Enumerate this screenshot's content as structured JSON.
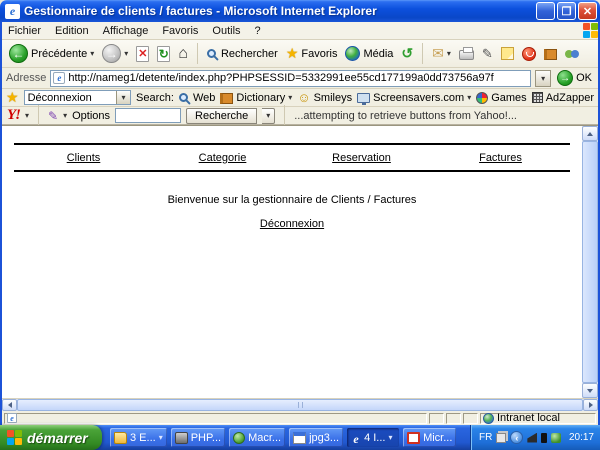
{
  "window": {
    "title": "Gestionnaire de clients / factures - Microsoft Internet Explorer"
  },
  "menubar": {
    "items": [
      "Fichier",
      "Edition",
      "Affichage",
      "Favoris",
      "Outils",
      "?"
    ]
  },
  "toolbar": {
    "back_label": "Précédente",
    "search_label": "Rechercher",
    "favorites_label": "Favoris",
    "media_label": "Média"
  },
  "addressbar": {
    "label": "Adresse",
    "url": "http://nameg1/detente/index.php?PHPSESSID=5332991ee55cd177199a0dd73756a97f",
    "go_label": "OK"
  },
  "search_toolbar": {
    "combo_value": "Déconnexion",
    "search_label": "Search:",
    "items": [
      "Web",
      "Dictionary",
      "Smileys",
      "Screensavers.com",
      "Games",
      "AdZapper"
    ]
  },
  "yahoo_toolbar": {
    "logo": "Y!",
    "options_label": "Options",
    "search_button": "Recherche",
    "status_message": "...attempting to retrieve buttons from Yahoo!..."
  },
  "page": {
    "nav_links": [
      "Clients",
      "Categorie",
      "Reservation",
      "Factures"
    ],
    "welcome_text": "Bienvenue sur la gestionnaire de Clients / Factures",
    "logout_link": "Déconnexion"
  },
  "statusbar": {
    "zone_label": "Intranet local"
  },
  "taskbar": {
    "start_label": "démarrer",
    "buttons": [
      {
        "label": "3 E...",
        "grouped": true
      },
      {
        "label": "PHP..."
      },
      {
        "label": "Macr..."
      },
      {
        "label": "jpg3..."
      },
      {
        "label": "4 I...",
        "grouped": true,
        "active": true
      },
      {
        "label": "Micr..."
      }
    ],
    "tray": {
      "language": "FR",
      "time": "20:17"
    }
  },
  "icons": {
    "back_arrow": "←",
    "forward_arrow": "→",
    "stop_x": "✕",
    "refresh": "↻",
    "home": "⌂",
    "star": "★",
    "history": "↺",
    "mail": "✉",
    "edit": "✎",
    "smiley": "☺",
    "caret": "▾",
    "ok_arrow": "→",
    "chevron_left": "‹",
    "minimize": "_",
    "maximize": "❐",
    "close": "✕"
  },
  "colors": {
    "titlebar_blue": "#0c50dd",
    "taskbar_blue": "#2158d0",
    "start_green": "#338a23",
    "close_red": "#dd5038",
    "toolbar_beige": "#f1efe2",
    "link_black": "#000000",
    "go_green": "#28a228"
  }
}
